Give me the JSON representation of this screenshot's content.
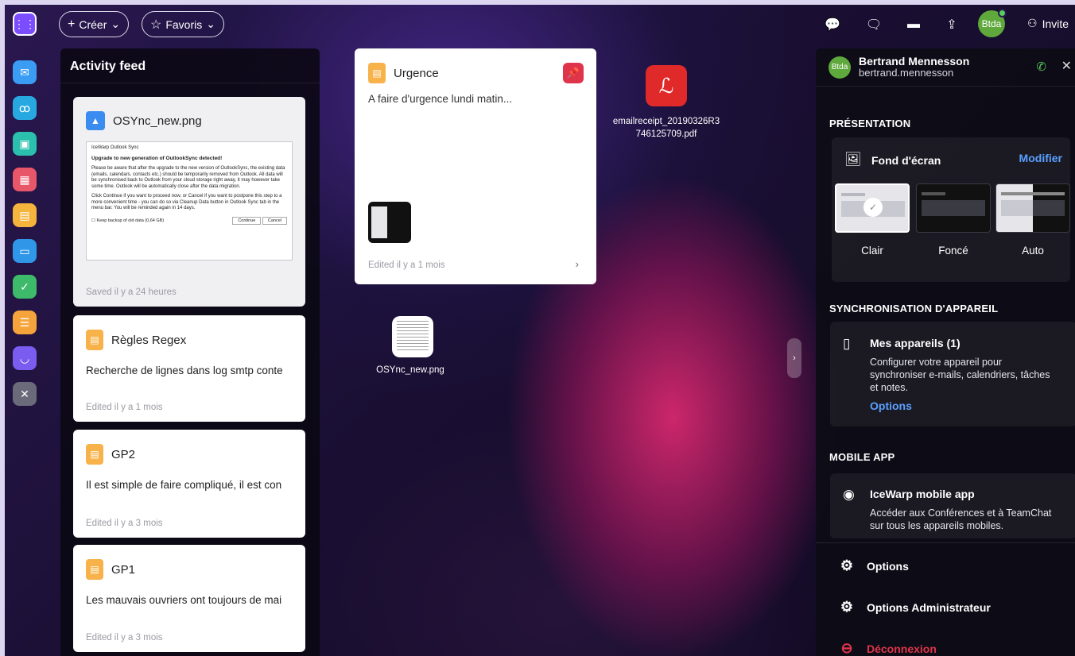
{
  "topbar": {
    "create_label": "Créer",
    "favorites_label": "Favoris",
    "avatar_initials": "Btda",
    "invite_label": "Invite"
  },
  "activity_feed": {
    "title": "Activity feed",
    "items": [
      {
        "title": "OSYnc_new.png",
        "meta": "Saved il y a 24 heures",
        "preview": {
          "window_title": "IceWarp Outlook Sync",
          "heading": "Upgrade to new generation of OutlookSync detected!",
          "body1": "Please be aware that after the upgrade to the new version of OutlookSync, the existing data (emails, calendars, contacts etc.) should be temporarily removed from Outlook. All data will be synchronised back to Outlook from your cloud storage right away, it may however take some time. Outlook will be automatically close after the data migration.",
          "body2": "Click Continue if you want to proceed now, or Cancel if you want to postpone this step to a more convenient time - you can do so via Cleanup Data button in Outlook Sync tab in the menu bar. You will be reminded again in 14 days.",
          "checkbox": "Keep backup of old data (0,64 GB)",
          "continue": "Continue",
          "cancel": "Cancel"
        }
      },
      {
        "title": "Règles Regex",
        "text": "Recherche de lignes dans log smtp conte",
        "meta": "Edited il y a 1 mois"
      },
      {
        "title": "GP2",
        "text": "Il est simple de faire compliqué, il est con",
        "meta": "Edited il y a 3 mois"
      },
      {
        "title": "GP1",
        "text": "Les mauvais ouvriers ont toujours de mai",
        "meta": "Edited il y a 3 mois"
      }
    ]
  },
  "urgence": {
    "title": "Urgence",
    "text": "A faire d'urgence lundi matin...",
    "meta": "Edited il y a 1 mois"
  },
  "desktop": {
    "pdf_name": "emailreceipt_20190326R3 746125709.pdf",
    "png_name": "OSYnc_new.png"
  },
  "panel": {
    "user_name": "Bertrand Mennesson",
    "user_login": "bertrand.mennesson",
    "avatar_initials": "Btda",
    "presentation_title": "PRÉSENTATION",
    "wallpaper_label": "Fond d'écran",
    "modify_label": "Modifier",
    "themes": [
      "Clair",
      "Foncé",
      "Auto"
    ],
    "sync_title": "SYNCHRONISATION D'APPAREIL",
    "devices_label": "Mes appareils (1)",
    "devices_desc": "Configurer votre appareil pour synchroniser e-mails, calendriers, tâches et notes.",
    "devices_options": "Options",
    "mobile_title": "MOBILE APP",
    "mobile_label": "IceWarp mobile app",
    "mobile_desc": "Accéder aux Conférences et à TeamChat sur tous les appareils mobiles.",
    "options_label": "Options",
    "admin_options_label": "Options Administrateur",
    "logout_label": "Déconnexion"
  },
  "colors": {
    "accent": "#7c4dff",
    "link": "#5aa0ff",
    "logout": "#e0344a",
    "note": "#f7b24a"
  }
}
